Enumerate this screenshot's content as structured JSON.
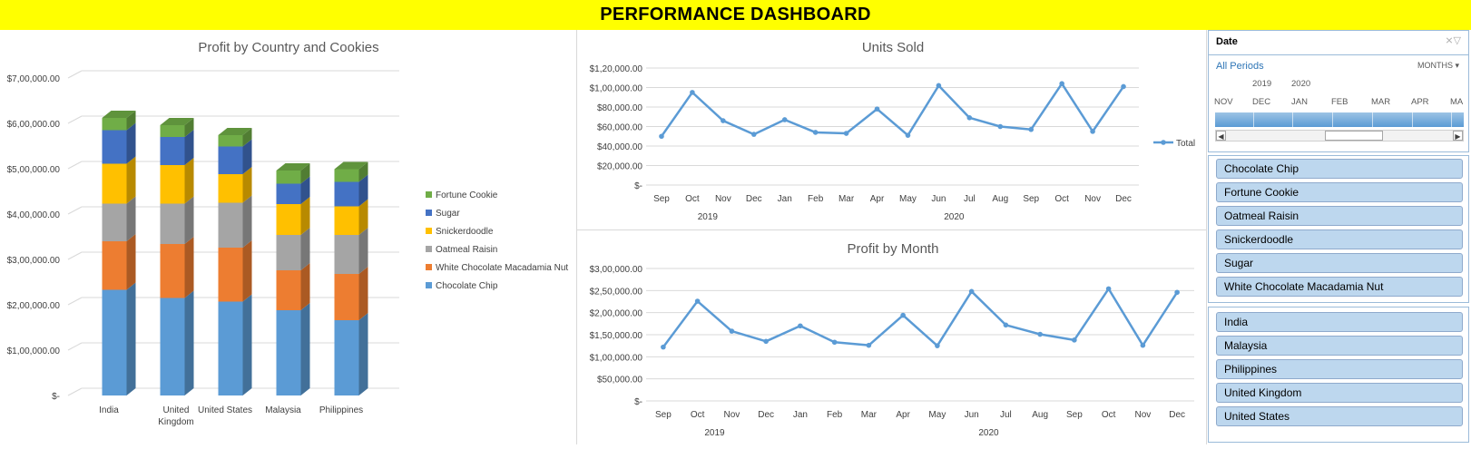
{
  "header": {
    "title": "PERFORMANCE DASHBOARD"
  },
  "colors": {
    "title_bg": "#ffff00",
    "chocolate_chip": "#5b9bd5",
    "white_choc": "#ed7d31",
    "oatmeal": "#a5a5a5",
    "snickerdoodle": "#ffc000",
    "sugar": "#4472c4",
    "fortune": "#70ad47",
    "line": "#5b9bd5",
    "slicer_item": "#bdd7ee"
  },
  "chart_data": [
    {
      "type": "bar",
      "stacked": true,
      "style": "3d-column",
      "title": "Profit by Country and Cookies",
      "categories": [
        "India",
        "United Kingdom",
        "United States",
        "Malaysia",
        "Philippines"
      ],
      "series": [
        {
          "name": "Chocolate Chip",
          "color": "#5b9bd5",
          "values": [
            233000,
            215000,
            207000,
            188000,
            166000
          ]
        },
        {
          "name": "White Chocolate Macadamia Nut",
          "color": "#ed7d31",
          "values": [
            107000,
            119000,
            119000,
            88000,
            102000
          ]
        },
        {
          "name": "Oatmeal Raisin",
          "color": "#a5a5a5",
          "values": [
            83000,
            89000,
            99000,
            78000,
            86000
          ]
        },
        {
          "name": "Snickerdoodle",
          "color": "#ffc000",
          "values": [
            88000,
            85000,
            63000,
            68000,
            63000
          ]
        },
        {
          "name": "Sugar",
          "color": "#4472c4",
          "values": [
            74000,
            62000,
            61000,
            45000,
            54000
          ]
        },
        {
          "name": "Fortune Cookie",
          "color": "#70ad47",
          "values": [
            27000,
            26000,
            25000,
            29000,
            28000
          ]
        }
      ],
      "ylim": [
        0,
        700000
      ],
      "yticks": [
        "$-",
        "$1,00,000.00",
        "$2,00,000.00",
        "$3,00,000.00",
        "$4,00,000.00",
        "$5,00,000.00",
        "$6,00,000.00",
        "$7,00,000.00"
      ],
      "legend_position": "right",
      "grid": true
    },
    {
      "type": "line",
      "title": "Units Sold",
      "x": [
        "Sep",
        "Oct",
        "Nov",
        "Dec",
        "Jan",
        "Feb",
        "Mar",
        "Apr",
        "May",
        "Jun",
        "Jul",
        "Aug",
        "Sep",
        "Oct",
        "Nov",
        "Dec"
      ],
      "year_labels": [
        "2019",
        "2020"
      ],
      "series": [
        {
          "name": "Total",
          "values": [
            50000,
            95000,
            66000,
            52000,
            67000,
            54000,
            53000,
            78000,
            51000,
            102000,
            69000,
            60000,
            57000,
            104000,
            55000,
            101000
          ]
        }
      ],
      "ylim": [
        0,
        120000
      ],
      "yticks": [
        "$-",
        "$20,000.00",
        "$40,000.00",
        "$60,000.00",
        "$80,000.00",
        "$1,00,000.00",
        "$1,20,000.00"
      ],
      "legend_position": "right",
      "grid": true
    },
    {
      "type": "line",
      "title": "Profit by Month",
      "x": [
        "Sep",
        "Oct",
        "Nov",
        "Dec",
        "Jan",
        "Feb",
        "Mar",
        "Apr",
        "May",
        "Jun",
        "Jul",
        "Aug",
        "Sep",
        "Oct",
        "Nov",
        "Dec"
      ],
      "year_labels": [
        "2019",
        "2020"
      ],
      "series": [
        {
          "values": [
            122000,
            226000,
            158000,
            135000,
            170000,
            133000,
            126000,
            194000,
            125000,
            248000,
            172000,
            151000,
            138000,
            254000,
            126000,
            246000
          ]
        }
      ],
      "ylim": [
        0,
        300000
      ],
      "yticks": [
        "$-",
        "$50,000.00",
        "$1,00,000.00",
        "$1,50,000.00",
        "$2,00,000.00",
        "$2,50,000.00",
        "$3,00,000.00"
      ],
      "grid": true
    }
  ],
  "timeline": {
    "title": "Date",
    "periods_label": "All Periods",
    "level_label": "MONTHS",
    "years": [
      "2019",
      "2020"
    ],
    "months": [
      "NOV",
      "DEC",
      "JAN",
      "FEB",
      "MAR",
      "APR",
      "MA"
    ],
    "icons": {
      "filter": "clear-filter-icon",
      "dropdown": "chevron-down-icon",
      "left": "scroll-left-icon",
      "right": "scroll-right-icon"
    }
  },
  "slicer_products": {
    "items": [
      "Chocolate Chip",
      "Fortune Cookie",
      "Oatmeal Raisin",
      "Snickerdoodle",
      "Sugar",
      "White Chocolate Macadamia Nut"
    ]
  },
  "slicer_countries": {
    "items": [
      "India",
      "Malaysia",
      "Philippines",
      "United Kingdom",
      "United States"
    ]
  }
}
